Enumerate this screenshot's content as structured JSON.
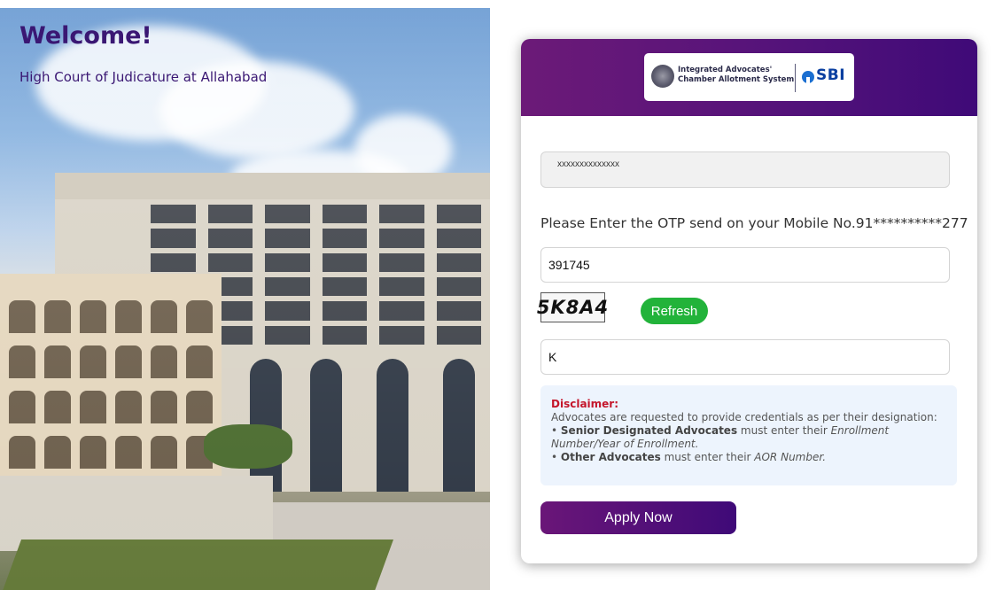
{
  "hero": {
    "title": "Welcome!",
    "subtitle": "High Court of Judicature at Allahabad"
  },
  "logo": {
    "line1": "Integrated Advocates'",
    "line2": "Chamber Allotment System",
    "bank": "SBI"
  },
  "form": {
    "masked_id": "xxxxxxxxxxxxxx",
    "otp_label": "Please Enter the OTP send on your Mobile No.91**********277",
    "otp_value": "391745",
    "captcha_text": "5K8A4",
    "refresh_label": "Refresh",
    "captcha_value": "K",
    "apply_label": "Apply Now"
  },
  "disclaimer": {
    "title": "Disclaimer:",
    "intro": "Advocates are requested to provide credentials as per their designation:",
    "item1_bold": "Senior Designated Advocates",
    "item1_text": " must enter their ",
    "item1_italic": "Enrollment Number/Year of Enrollment.",
    "item2_bold": "Other Advocates",
    "item2_text": " must enter their ",
    "item2_italic": "AOR Number."
  },
  "colors": {
    "brand_purple": "#3a1773",
    "header_gradient_start": "#6c1a78",
    "refresh_green": "#22b33a",
    "disclaimer_red": "#c4162a"
  }
}
